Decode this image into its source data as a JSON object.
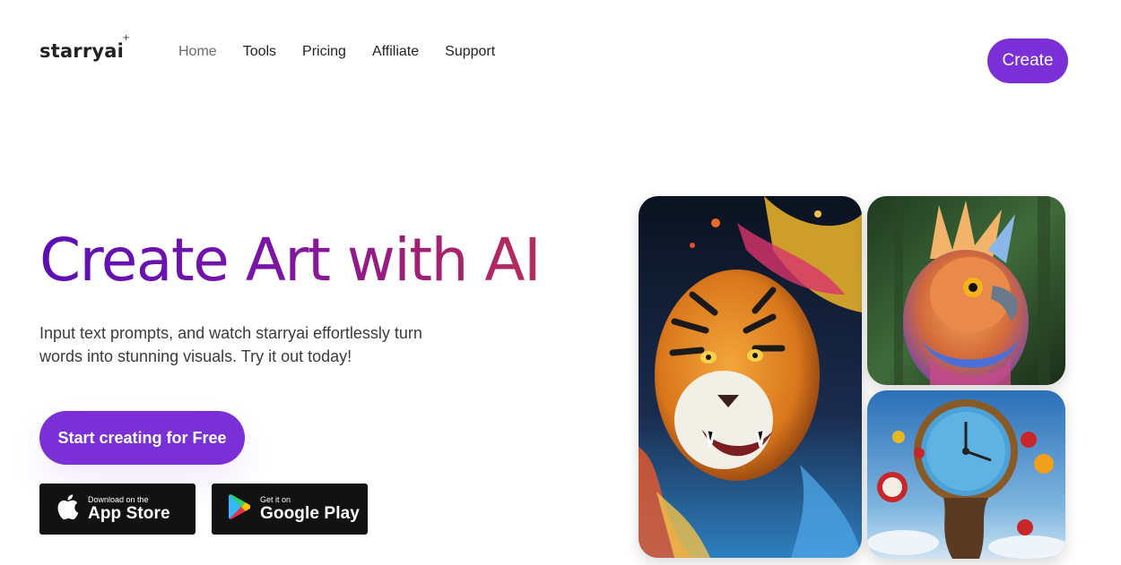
{
  "header": {
    "logo": "starryai",
    "nav": [
      {
        "label": "Home"
      },
      {
        "label": "Tools"
      },
      {
        "label": "Pricing"
      },
      {
        "label": "Affiliate"
      },
      {
        "label": "Support"
      }
    ],
    "create_label": "Create"
  },
  "hero": {
    "title": "Create Art with AI",
    "subtitle": "Input text prompts, and watch starryai effortlessly turn words into stunning visuals. Try it out today!",
    "cta_label": "Start creating for Free",
    "app_store": {
      "small": "Download on the",
      "big": "App Store"
    },
    "google_play": {
      "small": "Get it on",
      "big": "Google Play"
    }
  },
  "colors": {
    "brand_purple": "#7b2fd6",
    "title_gradient_start": "#5b0fb5",
    "title_gradient_end": "#b82d5c",
    "store_badge": "#121212"
  },
  "gallery": [
    {
      "name": "tiger-artwork"
    },
    {
      "name": "bird-artwork"
    },
    {
      "name": "melting-clock-artwork"
    }
  ]
}
